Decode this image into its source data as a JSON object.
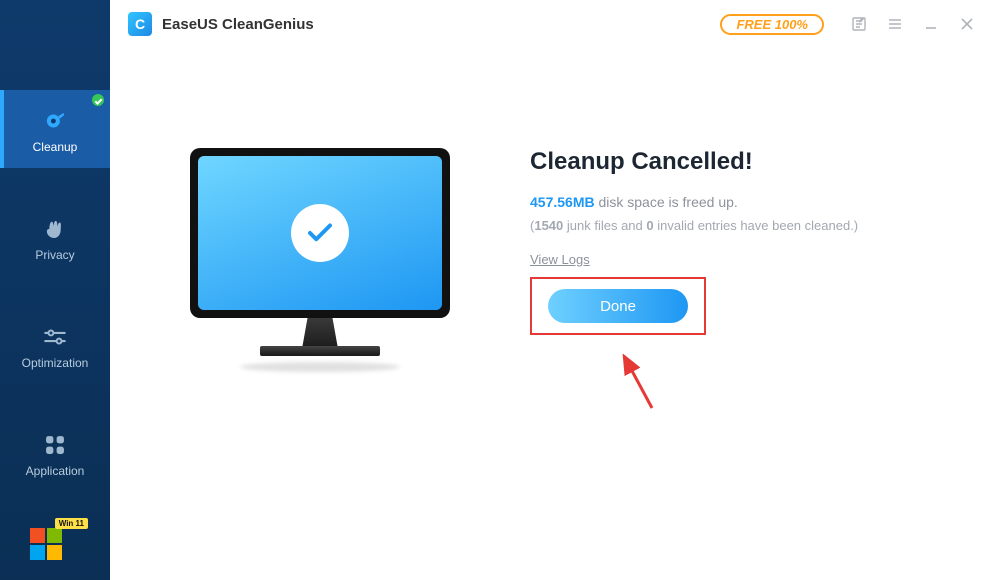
{
  "app": {
    "logo_letter": "C",
    "title": "EaseUS CleanGenius",
    "free_label": "FREE 100%"
  },
  "sidebar": {
    "items": [
      {
        "label": "Cleanup"
      },
      {
        "label": "Privacy"
      },
      {
        "label": "Optimization"
      },
      {
        "label": "Application"
      }
    ],
    "start_badge": "Win 11"
  },
  "result": {
    "headline": "Cleanup Cancelled!",
    "freed_amount": "457.56MB",
    "freed_rest": " disk space is freed up.",
    "junk_count": "1540",
    "junk_label": " junk files and ",
    "invalid_count": "0",
    "invalid_label": " invalid entries have been cleaned.)",
    "paren_open": "(",
    "view_logs": "View Logs",
    "done_label": "Done"
  }
}
